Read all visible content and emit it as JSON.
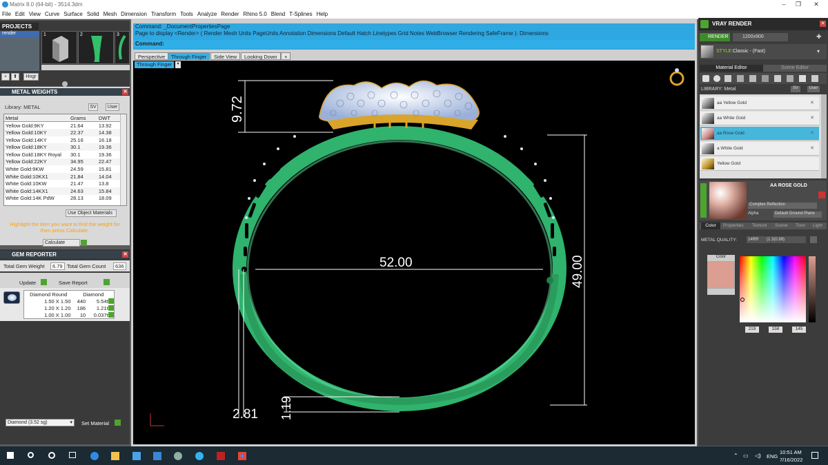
{
  "window": {
    "title": "Matrix 8.0 (64-bit) - 3514.3dm",
    "minimize": "–",
    "maximize": "❐",
    "close": "✕"
  },
  "menu": [
    "File",
    "Edit",
    "View",
    "Curve",
    "Surface",
    "Solid",
    "Mesh",
    "Dimension",
    "Transform",
    "Tools",
    "Analyze",
    "Render",
    "Rhino 5.0",
    "Blend",
    "T-Splines",
    "Help"
  ],
  "projects": {
    "title": "PROJECTS",
    "tree_item": "render",
    "thumbs": [
      "1",
      "2",
      "3"
    ],
    "hinge_btn": "Hngr"
  },
  "metal_weights": {
    "title": "METAL WEIGHTS",
    "library_label": "Library: METAL",
    "sv_btn": "SV",
    "user_btn": "User",
    "columns": [
      "Metal",
      "Grams",
      "DWT"
    ],
    "rows": [
      [
        "Yellow Gold:9KY",
        "21.64",
        "13.92"
      ],
      [
        "Yellow Gold:10KY",
        "22.37",
        "14.38"
      ],
      [
        "Yellow Gold:14KY",
        "25.16",
        "16.18"
      ],
      [
        "Yellow Gold:18KY",
        "30.1",
        "19.36"
      ],
      [
        "Yellow Gold:18KY Royal",
        "30.1",
        "19.36"
      ],
      [
        "Yellow Gold:22KY",
        "34.95",
        "22.47"
      ],
      [
        "White Gold:9KW",
        "24.59",
        "15.81"
      ],
      [
        "White Gold:10KX1",
        "21.84",
        "14.04"
      ],
      [
        "White Gold:10KW",
        "21.47",
        "13.8"
      ],
      [
        "White Gold:14KX1",
        "24.63",
        "15.84"
      ],
      [
        "White Gold:14K PdW",
        "28.13",
        "18.09"
      ]
    ],
    "use_object_materials": "Use Object Materials",
    "hint": "Highlight the item you want to find the weight for then press Calculate.",
    "calculate": "Calculate"
  },
  "gem_reporter": {
    "title": "GEM REPORTER",
    "total_weight_label": "Total Gem Weight",
    "total_weight": "6.79",
    "total_count_label": "Total Gem Count",
    "total_count": "636",
    "update": "Update",
    "save_report": "Save Report",
    "col1": "Diamond Round",
    "col2": "Diamond",
    "rows": [
      [
        "1.50 X 1.50",
        "440",
        "5.54tw"
      ],
      [
        "1.20 X 1.20",
        "186",
        "1.21tw"
      ],
      [
        "1.00 X 1.00",
        "10",
        "0.037tw"
      ]
    ],
    "material_select": "Diamond    (3.52 sg)",
    "set_material": "Set Material"
  },
  "command": {
    "line1": "Command: _DocumentPropertiesPage",
    "line2": "Page to display <Render> ( Render  Mesh  Units  PageUnits  Annotation  Dimensions  Default  Hatch  Linetypes  Grid  Notes  WebBrowser  Rendering  SafeFrame ): Dimensions",
    "prompt": "Command:"
  },
  "viewport_tabs": [
    "Perspective",
    "Through Finger",
    "Side View",
    "Looking Down",
    "+"
  ],
  "viewport_label": "Through Finger",
  "dimensions": {
    "top": "9.72",
    "width": "52.00",
    "height": "49.00",
    "band": "1.19",
    "thickness": "2.81"
  },
  "vray": {
    "title": "VRAY RENDER",
    "render_btn": "RENDER",
    "resolution": "1200x900",
    "style_label": "STYLE:",
    "style_value": "Classic - (Fast)",
    "tab_material": "Material Editor",
    "tab_scene": "Scene Editor",
    "library_label": "LIBRARY: Metal",
    "materials": [
      "aa Yellow Gold",
      "aa White Gold",
      "aa Rose Gold",
      "a White Gold",
      "Yellow Gold"
    ],
    "preview_title": "AA ROSE GOLD",
    "reflection": "Complex Reflection",
    "alpha": "Alpha",
    "ground": "Default Ground Plane",
    "sub_tabs": [
      "Color",
      "Properties",
      "Texture",
      "Scene",
      "Toon",
      "Light"
    ],
    "metal_quality_label": "METAL QUALITY:",
    "metal_quality": "14RR",
    "metal_quality_extra": "(1.3(0.99)",
    "color_label": "Color",
    "rgb": [
      "219",
      "158",
      "145"
    ],
    "swatch": "#db9e91"
  },
  "taskbar": {
    "lang": "ENG",
    "time": "10:51 AM",
    "date": "7/16/2022"
  },
  "colors": {
    "accent": "#2fa7e0",
    "ring": "#2fb36d",
    "gold": "#d9a42a"
  }
}
